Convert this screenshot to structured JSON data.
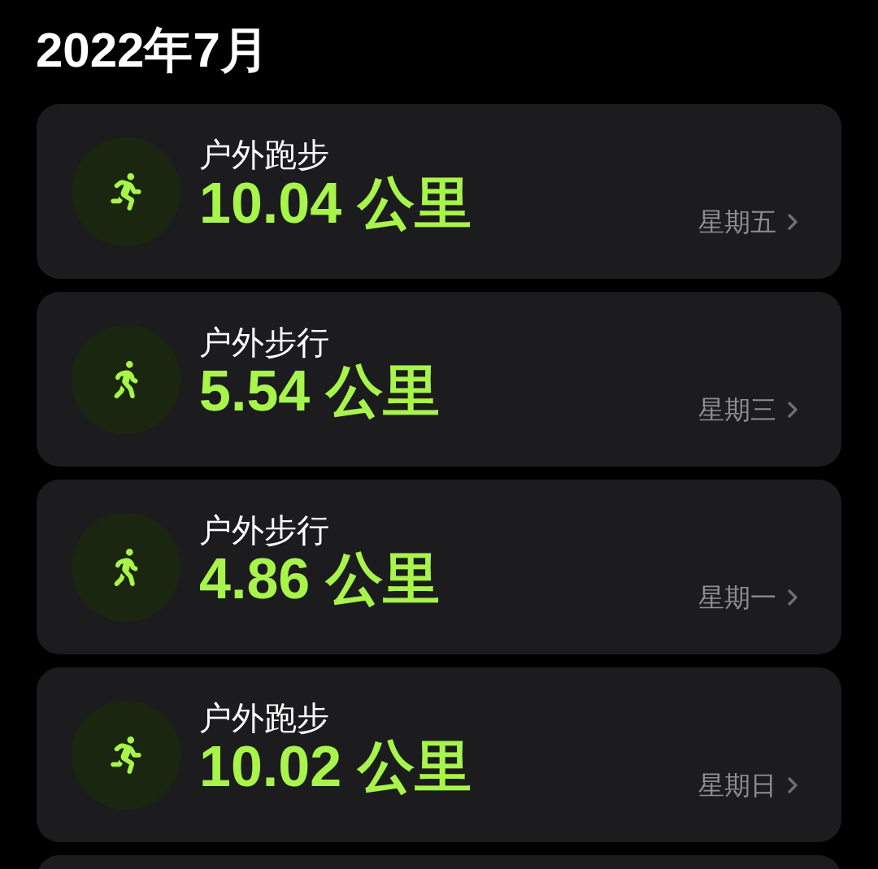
{
  "title": "2022年7月",
  "workouts": [
    {
      "kind": "run",
      "name": "户外跑步",
      "distance": "10.04 公里",
      "day": "星期五"
    },
    {
      "kind": "walk",
      "name": "户外步行",
      "distance": "5.54 公里",
      "day": "星期三"
    },
    {
      "kind": "walk",
      "name": "户外步行",
      "distance": "4.86 公里",
      "day": "星期一"
    },
    {
      "kind": "run",
      "name": "户外跑步",
      "distance": "10.02 公里",
      "day": "星期日"
    }
  ]
}
